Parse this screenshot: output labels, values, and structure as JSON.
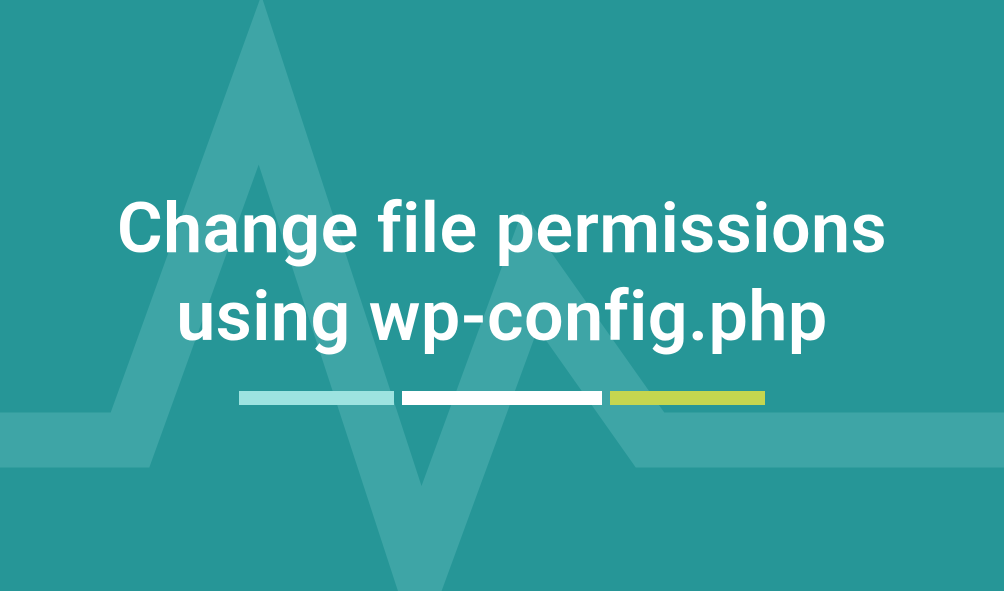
{
  "title": "Change file permissions using wp-config.php",
  "colors": {
    "background": "#269697",
    "heartbeat": "#3ea5a6",
    "bar_cyan": "#9de3e0",
    "bar_white": "#ffffff",
    "bar_lime": "#c5d64f"
  }
}
